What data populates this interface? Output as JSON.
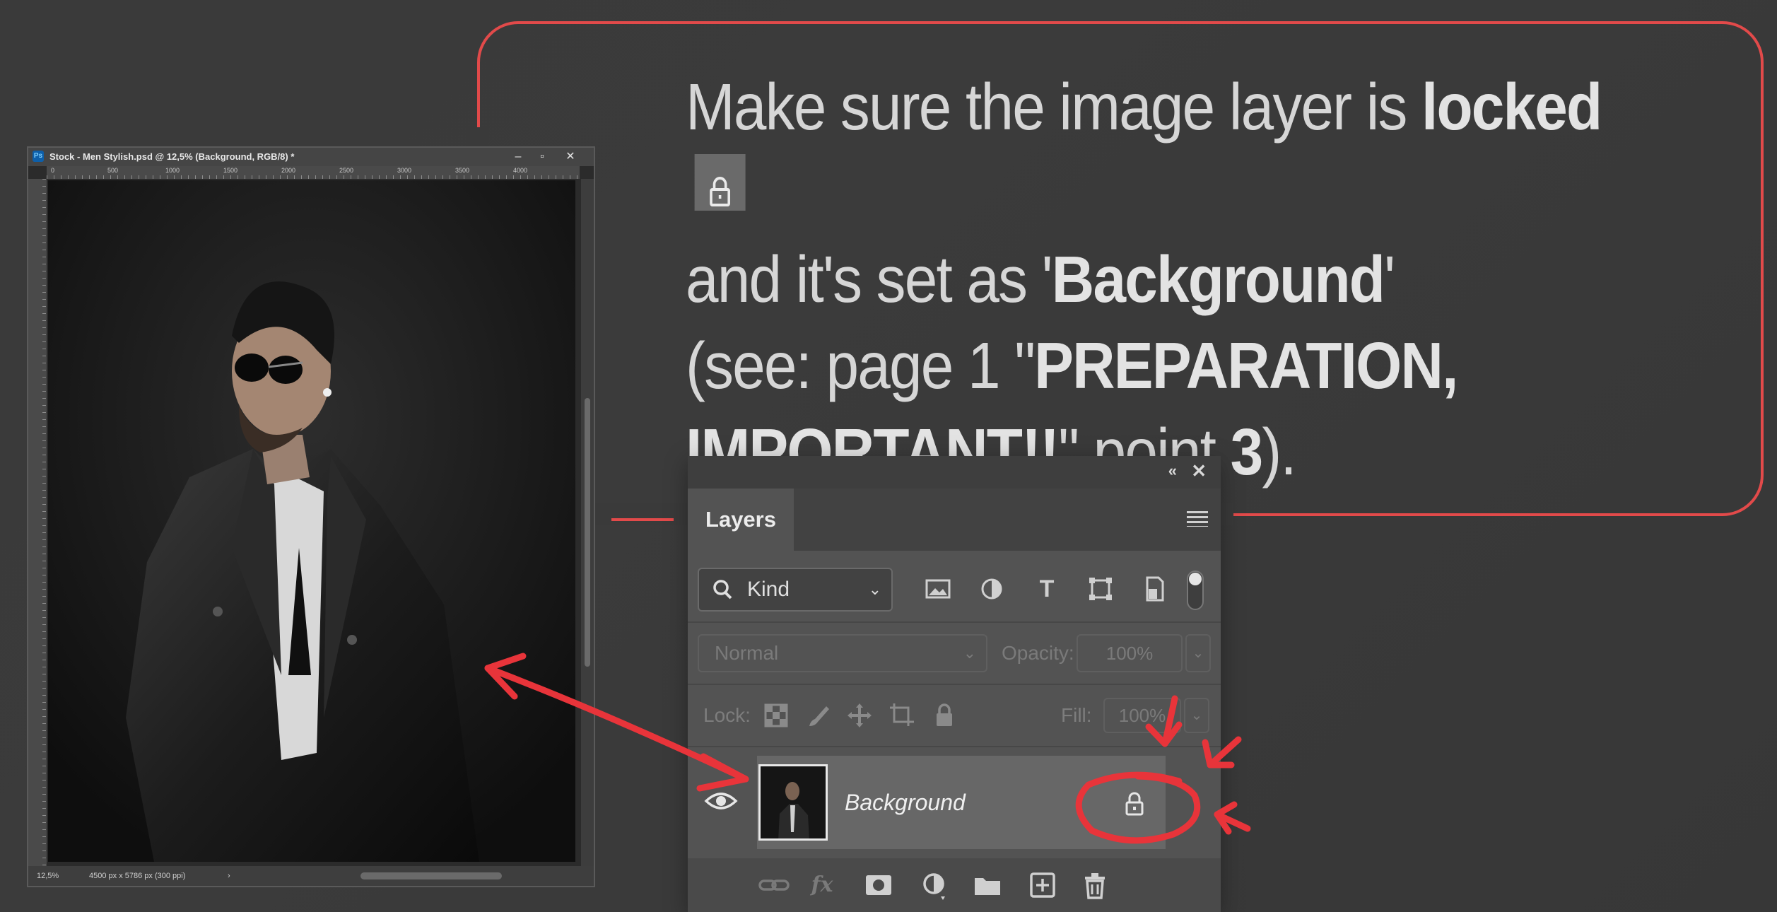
{
  "instructions": {
    "l1_a": "Make sure the image layer is ",
    "l1_b": "locked",
    "l2_a": "and it's set as '",
    "l2_b": "Background",
    "l2_c": "'",
    "l3_a": "(see: page 1 \"",
    "l3_b": "PREPARATION,",
    "l4_a": "IMPORTANT!!",
    "l4_b": "\" point ",
    "l4_c": "3",
    "l4_d": ")."
  },
  "document_window": {
    "app_badge": "Ps",
    "title": "Stock - Men Stylish.psd @ 12,5% (Background, RGB/8) *",
    "minimize": "–",
    "maximize": "▫",
    "close": "✕",
    "ruler_marks": [
      "0",
      "500",
      "1000",
      "1500",
      "2000",
      "2500",
      "3000",
      "3500",
      "4000"
    ],
    "zoom": "12,5%",
    "doc_size": "4500 px x 5786 px (300 ppi)",
    "status_chevron": "›"
  },
  "layers_panel": {
    "collapse": "«",
    "close": "✕",
    "tab": "Layers",
    "filter_kind": "Kind",
    "blend_mode": "Normal",
    "opacity_label": "Opacity:",
    "opacity_value": "100%",
    "lock_label": "Lock:",
    "fill_label": "Fill:",
    "fill_value": "100%",
    "layer_name": "Background",
    "layer_locked": true
  },
  "colors": {
    "background": "#3a3a3a",
    "accent_red": "#e24a4a",
    "panel": "#535353",
    "text": "#d6d6d6"
  },
  "icons": {
    "filter_buttons": [
      "image-filter-icon",
      "adjustment-filter-icon",
      "type-filter-icon",
      "shape-filter-icon",
      "smart-object-filter-icon"
    ],
    "lock_buttons": [
      "lock-transparent-pixels-icon",
      "lock-image-pixels-icon",
      "lock-position-icon",
      "lock-artboard-icon",
      "lock-all-icon"
    ],
    "bottom_buttons": [
      "link-layers-icon",
      "fx-icon",
      "add-mask-icon",
      "adjustment-layer-icon",
      "new-group-icon",
      "new-layer-icon",
      "delete-layer-icon"
    ]
  }
}
